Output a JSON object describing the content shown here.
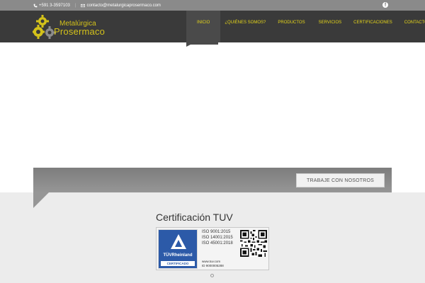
{
  "topbar": {
    "phone": "+591 3-3597103",
    "email": "contacto@metalurgicaprosermaco.com",
    "phone_icon": "phone-icon",
    "email_icon": "envelope-icon",
    "social_icon": "facebook-icon"
  },
  "logo": {
    "line1": "Metalúrgica",
    "line2": "Prosermaco",
    "icon": "gears-icon"
  },
  "nav": {
    "items": [
      "INICIO",
      "¿QUIÉNES SOMOS?",
      "PRODUCTOS",
      "SERVICIOS",
      "CERTIFICACIONES",
      "CONTACTO"
    ],
    "active_index": 0
  },
  "band": {
    "button_label": "TRABAJE CON NOSOTROS"
  },
  "certification": {
    "title": "Certificación TUV",
    "badge_brand": "TÜVRheinland",
    "badge_label": "CERTIFICADO",
    "iso_lines": [
      "ISO 9001:2015",
      "ISO 14001:2015",
      "ISO 45001:2018"
    ],
    "website": "www.tuv.com",
    "id_line": "ID 9000005288"
  },
  "colors": {
    "accent": "#e6d619",
    "header_bg": "#3a3a3a",
    "topbar_bg": "#8a8a8a",
    "badge_blue": "#2c5aa8"
  }
}
